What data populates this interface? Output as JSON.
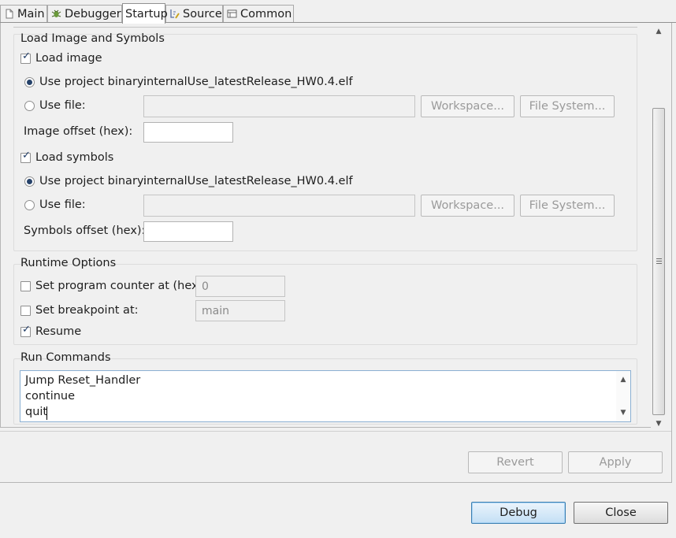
{
  "tabs": [
    {
      "label": "Main",
      "icon": "document-icon"
    },
    {
      "label": "Debugger",
      "icon": "bug-icon"
    },
    {
      "label": "Startup",
      "icon": ""
    },
    {
      "label": "Source",
      "icon": "source-icon"
    },
    {
      "label": "Common",
      "icon": "common-icon"
    }
  ],
  "load_image_group": {
    "title": "Load Image and Symbols",
    "load_image_label": "Load image",
    "load_image_checked": true,
    "use_project_binary_label": "Use project binary:",
    "project_binary_value": "internalUse_latestRelease_HW0.4.elf",
    "use_file_label": "Use file:",
    "workspace_label": "Workspace...",
    "file_system_label": "File System...",
    "image_offset_label": "Image offset (hex):",
    "image_offset_value": "",
    "load_symbols_label": "Load symbols",
    "load_symbols_checked": true,
    "symbols_use_project_binary_label": "Use project binary:",
    "symbols_project_binary_value": "internalUse_latestRelease_HW0.4.elf",
    "symbols_use_file_label": "Use file:",
    "symbols_workspace_label": "Workspace...",
    "symbols_file_system_label": "File System...",
    "symbols_offset_label": "Symbols offset (hex):",
    "symbols_offset_value": ""
  },
  "runtime_options": {
    "title": "Runtime Options",
    "set_pc_label": "Set program counter at (hex):",
    "set_pc_value": "0",
    "set_breakpoint_label": "Set breakpoint at:",
    "set_breakpoint_value": "main",
    "resume_label": "Resume",
    "resume_checked": true
  },
  "run_commands": {
    "title": "Run Commands",
    "lines": [
      "Jump Reset_Handler",
      "continue",
      "quit"
    ]
  },
  "buttons": {
    "revert": "Revert",
    "apply": "Apply",
    "debug": "Debug",
    "close": "Close"
  },
  "colors": {
    "default_button_border": "#3c7fb1",
    "checkmark": "#1f3b66"
  }
}
